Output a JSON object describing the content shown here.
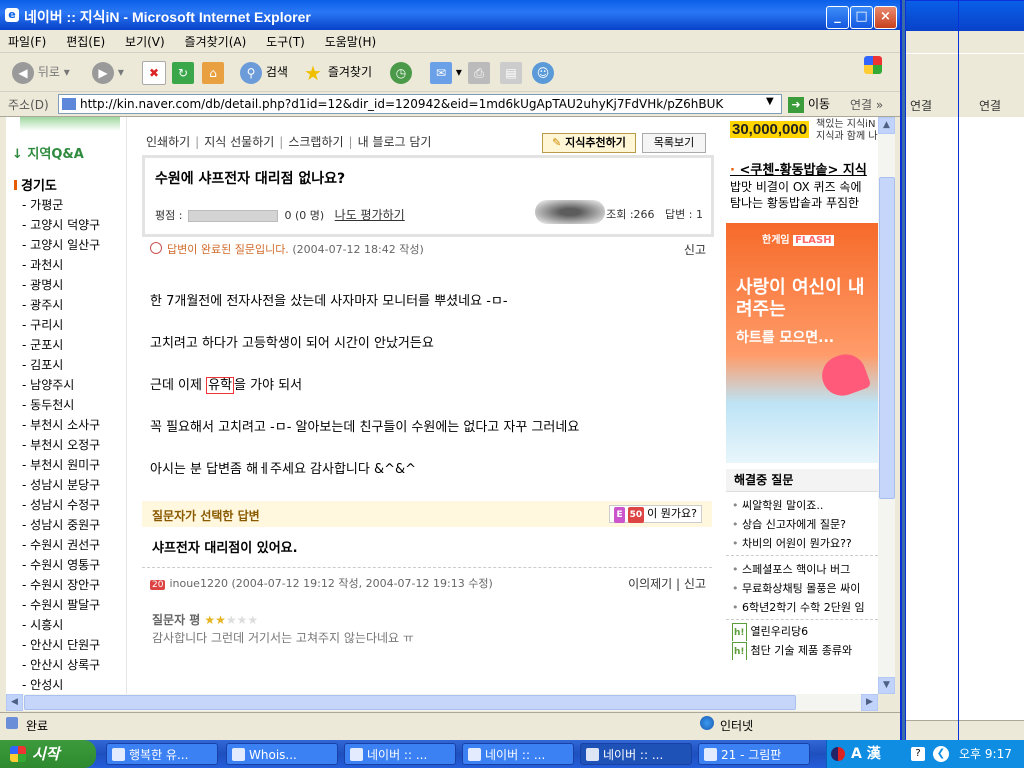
{
  "window": {
    "title": "네이버 :: 지식iN - Microsoft Internet Explorer",
    "min": "_",
    "max": "□",
    "close": "×"
  },
  "menu": [
    "파일(F)",
    "편집(E)",
    "보기(V)",
    "즐겨찾기(A)",
    "도구(T)",
    "도움말(H)"
  ],
  "toolbar": {
    "back": "뒤로",
    "search": "검색",
    "favorites": "즐겨찾기"
  },
  "address": {
    "label": "주소(D)",
    "url": "http://kin.naver.com/db/detail.php?d1id=12&dir_id=120942&eid=1md6kUgApTAU2uhyKj7FdVHk/pZ6hBUK",
    "go": "이동",
    "links": "연결"
  },
  "leftnav": {
    "region": "↓ 지역Q&A",
    "province": "경기도",
    "cities": [
      "가평군",
      "고양시 덕양구",
      "고양시 일산구",
      "과천시",
      "광명시",
      "광주시",
      "구리시",
      "군포시",
      "김포시",
      "남양주시",
      "동두천시",
      "부천시 소사구",
      "부천시 오정구",
      "부천시 원미구",
      "성남시 분당구",
      "성남시 수정구",
      "성남시 중원구",
      "수원시 권선구",
      "수원시 영통구",
      "수원시 장안구",
      "수원시 팔달구",
      "시흥시",
      "안산시 단원구",
      "안산시 상록구",
      "안성시"
    ]
  },
  "article": {
    "menu": [
      "인쇄하기",
      "지식 선물하기",
      "스크랩하기",
      "내 블로그 담기"
    ],
    "recommend": "지식추천하기",
    "list": "목록보기",
    "question_title": "수원에 샤프전자 대리점 없나요?",
    "rating_label": "평점 :",
    "rating_count": "0 (0 명)",
    "rate_me": "나도 평가하기",
    "views": "조회 :266",
    "answers": "답변 : 1",
    "status_done": "답변이 완료된 질문입니다.",
    "status_date": "(2004-07-12 18:42 작성)",
    "report": "신고",
    "body": [
      "한 7개월전에 전자사전을 샀는데 사자마자 모니터를 뿌셨네요 -ㅁ-",
      "고치려고 하다가 고등학생이 되어 시간이 안났거든요",
      "가야 되서",
      "꼭 필요해서 고치려고 -ㅁ- 알아보는데 친구들이 수원에는 없다고 자꾸 그러네요",
      "아시는 분 답변좀 해ㅔ주세요 감사합니다 &^&^"
    ],
    "body_line3_pre": "근데 이제 ",
    "body_line3_hl": "유학",
    "body_line3_post": "을 가야 되서",
    "selected_label": "질문자가 선택한 답변",
    "badge_e": "E",
    "badge_50": "50",
    "badge_what": "이 뭔가요?",
    "answer_title": "샤프전자 대리점이 있어요.",
    "answer_level": "20",
    "answer_user": "inoue1220",
    "answer_dates": "(2004-07-12 19:12 작성, 2004-07-12 19:13 수정)",
    "objection": "이의제기",
    "answer_report": "신고",
    "review_label": "질문자 평",
    "stars_on": "★★",
    "stars_off": "★★★",
    "review_text": "감사합니다 그런데 거기서는 고쳐주지 않는다네요 ㅠ"
  },
  "right": {
    "promo_amount": "30,000,000",
    "promo_text1": "책있는 지식iN",
    "promo_text2": "지식과 함께 나",
    "news_head": "<쿠첸-황동밥솥> 지식",
    "news_line1": "밥맛 비결이 OX 퀴즈 속에",
    "news_line2": "탐나는 황동밥솥과 푸짐한",
    "ad_top": "한게임",
    "ad_flash": "FLASH",
    "ad_text": "사랑이 여신이 내려주는",
    "ad_sub": "하트를 모으면...",
    "pending_head": "해결중 질문",
    "pending": [
      "씨알학원 말이죠..",
      "상습 신고자에게 질문?",
      "차비의 어원이 뭔가요??"
    ],
    "pending2": [
      "스페셜포스 핵이나 버그",
      "무료화상채팅 몰풍은 싸이",
      "6학년2학기 수학 2단원 임"
    ],
    "hlinks": [
      "열린우리당6",
      "첨단 기술 제품 종류와"
    ],
    "h_badge": "h!"
  },
  "status": {
    "text": "완료",
    "zone": "인터넷"
  },
  "taskbar": {
    "start": "시작",
    "tasks": [
      "행복한 유...",
      "Whois...",
      "네이버 :: ...",
      "네이버 :: ...",
      "네이버 :: ...",
      "21 - 그림판"
    ],
    "tray_lang": "A 漢",
    "clock": "오후 9:17"
  },
  "colors": {
    "title_blue": "#0a5fe8",
    "accent_green": "#2e8b3d",
    "accent_orange": "#e65c00"
  }
}
